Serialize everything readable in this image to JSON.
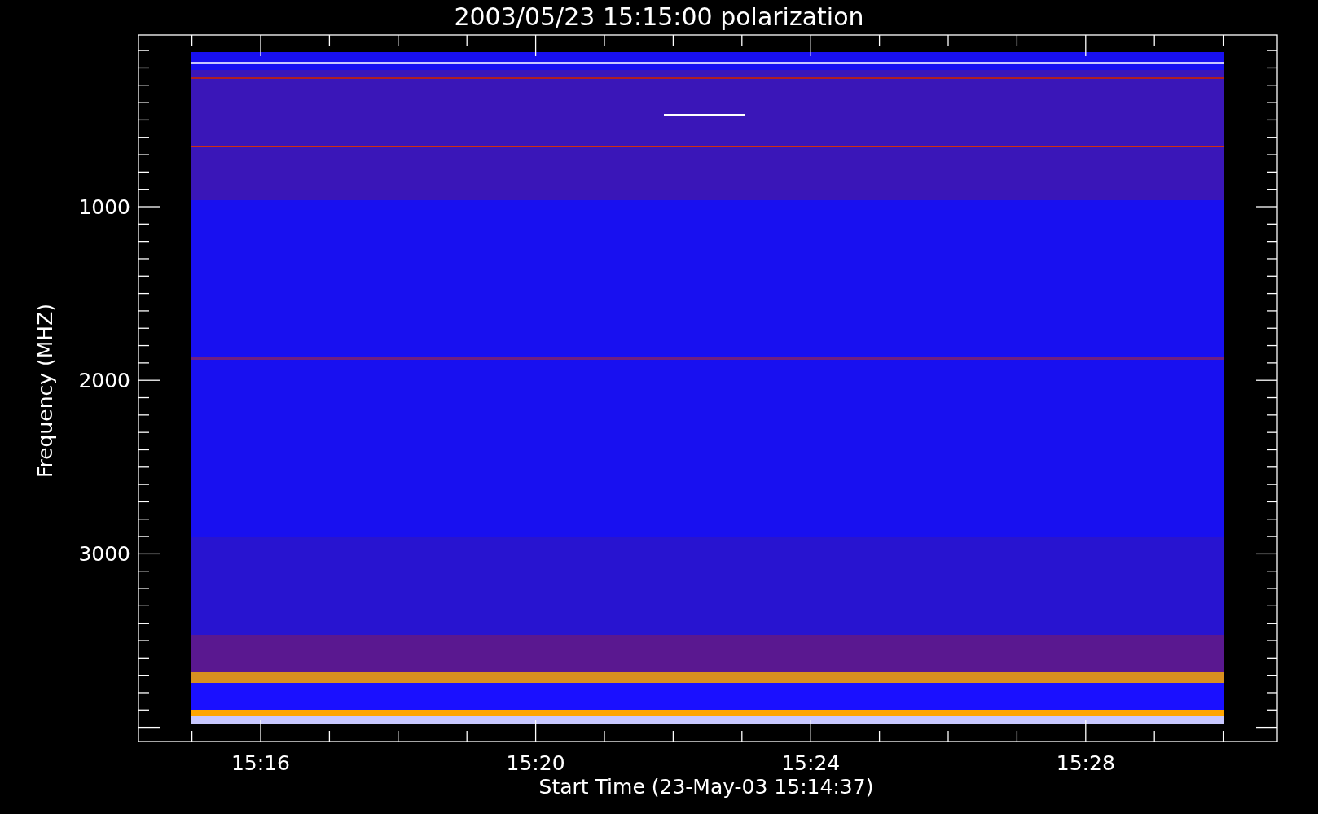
{
  "title": "2003/05/23 15:15:00 polarization",
  "x_axis": {
    "label": "Start Time (23-May-03 15:14:37)",
    "ticks": [
      "15:16",
      "15:20",
      "15:24",
      "15:28"
    ]
  },
  "y_axis": {
    "label": "Frequency (MHZ)",
    "ticks": [
      "1000",
      "2000",
      "3000"
    ]
  }
}
